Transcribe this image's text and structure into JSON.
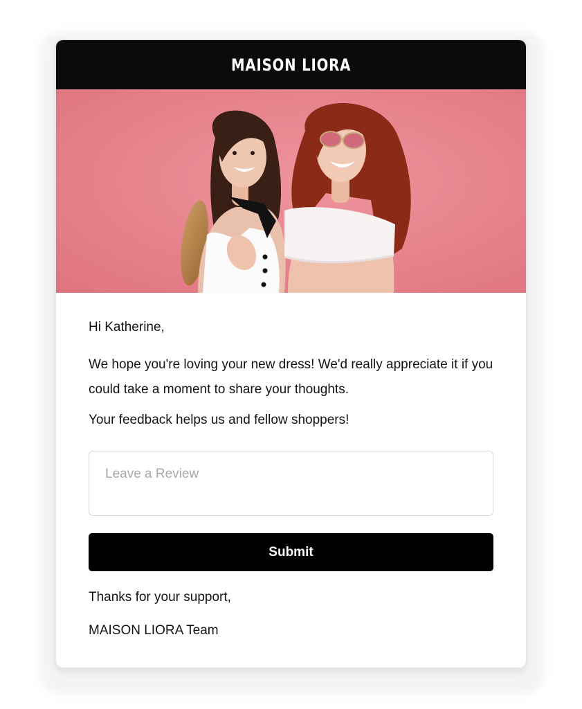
{
  "header": {
    "brand": "MAISON LIORA"
  },
  "hero": {
    "image": "two-smiling-women-pink-backdrop",
    "background_color": "#e8838d"
  },
  "message": {
    "greeting": "Hi Katherine,",
    "body": "We hope you're loving your new dress! We'd really appreciate it if you could take a moment to share your thoughts.",
    "tagline": "Your feedback helps us and fellow shoppers!"
  },
  "review": {
    "placeholder": "Leave a Review",
    "value": ""
  },
  "actions": {
    "submit_label": "Submit"
  },
  "footer": {
    "signoff": "Thanks for your support,",
    "team": "MAISON LIORA Team"
  },
  "colors": {
    "header_bg": "#0b0b0b",
    "button_bg": "#000000",
    "accent_pink": "#e8838d"
  }
}
